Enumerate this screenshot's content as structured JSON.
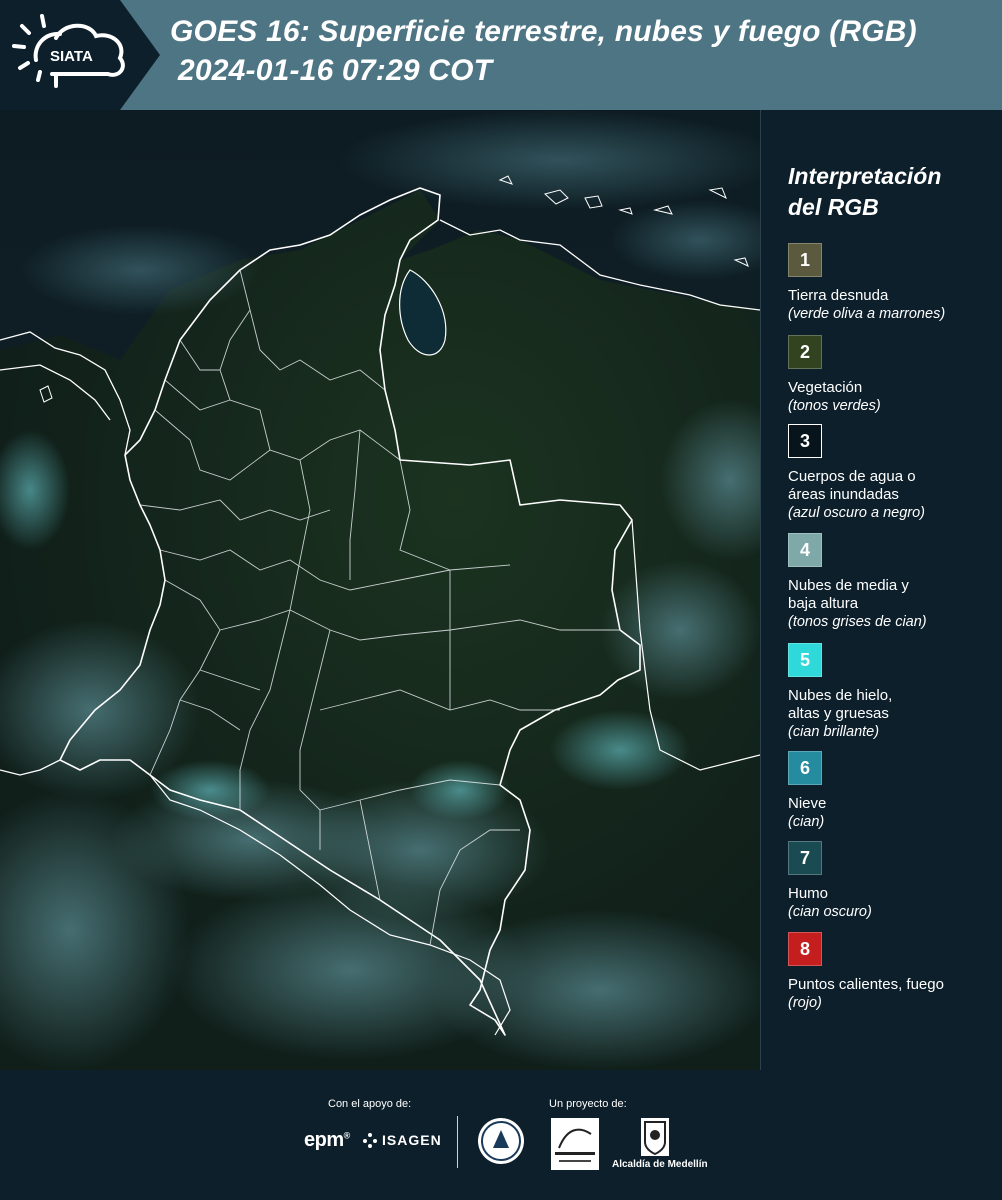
{
  "header": {
    "title_line1": "GOES 16: Superficie terrestre, nubes y fuego (RGB)",
    "title_line2": "2024-01-16 07:29 COT",
    "logo_text": "SIATA"
  },
  "legend": {
    "title_line1": "Interpretación",
    "title_line2": "del RGB",
    "items": [
      {
        "num": "1",
        "color": "#5b5a3e",
        "label": "Tierra desnuda",
        "desc": "(verde oliva a marrones)"
      },
      {
        "num": "2",
        "color": "#31431f",
        "label": "Vegetación",
        "desc": "(tonos verdes)"
      },
      {
        "num": "3",
        "color": "#07141c",
        "label": "Cuerpos de agua o áreas inundadas",
        "desc": "(azul oscuro a negro)"
      },
      {
        "num": "4",
        "color": "#7fa9a9",
        "label": "Nubes de media y baja altura",
        "desc": "(tonos grises de cian)"
      },
      {
        "num": "5",
        "color": "#2fd9d9",
        "label": "Nubes de hielo, altas y gruesas",
        "desc": "(cian brillante)"
      },
      {
        "num": "6",
        "color": "#248c9e",
        "label": "Nieve",
        "desc": "(cian)"
      },
      {
        "num": "7",
        "color": "#1b4b52",
        "label": "Humo",
        "desc": "(cian oscuro)"
      },
      {
        "num": "8",
        "color": "#c41e1e",
        "label": "Puntos calientes, fuego",
        "desc": "(rojo)"
      }
    ]
  },
  "footer": {
    "support_label": "Con el apoyo de:",
    "project_label": "Un proyecto de:",
    "sponsor1": "epm",
    "sponsor2": "ISAGEN",
    "partner_alcaldia": "Alcaldía de Medellín"
  },
  "colors": {
    "header_bar": "#4e7584",
    "background": "#0d1f2b"
  }
}
